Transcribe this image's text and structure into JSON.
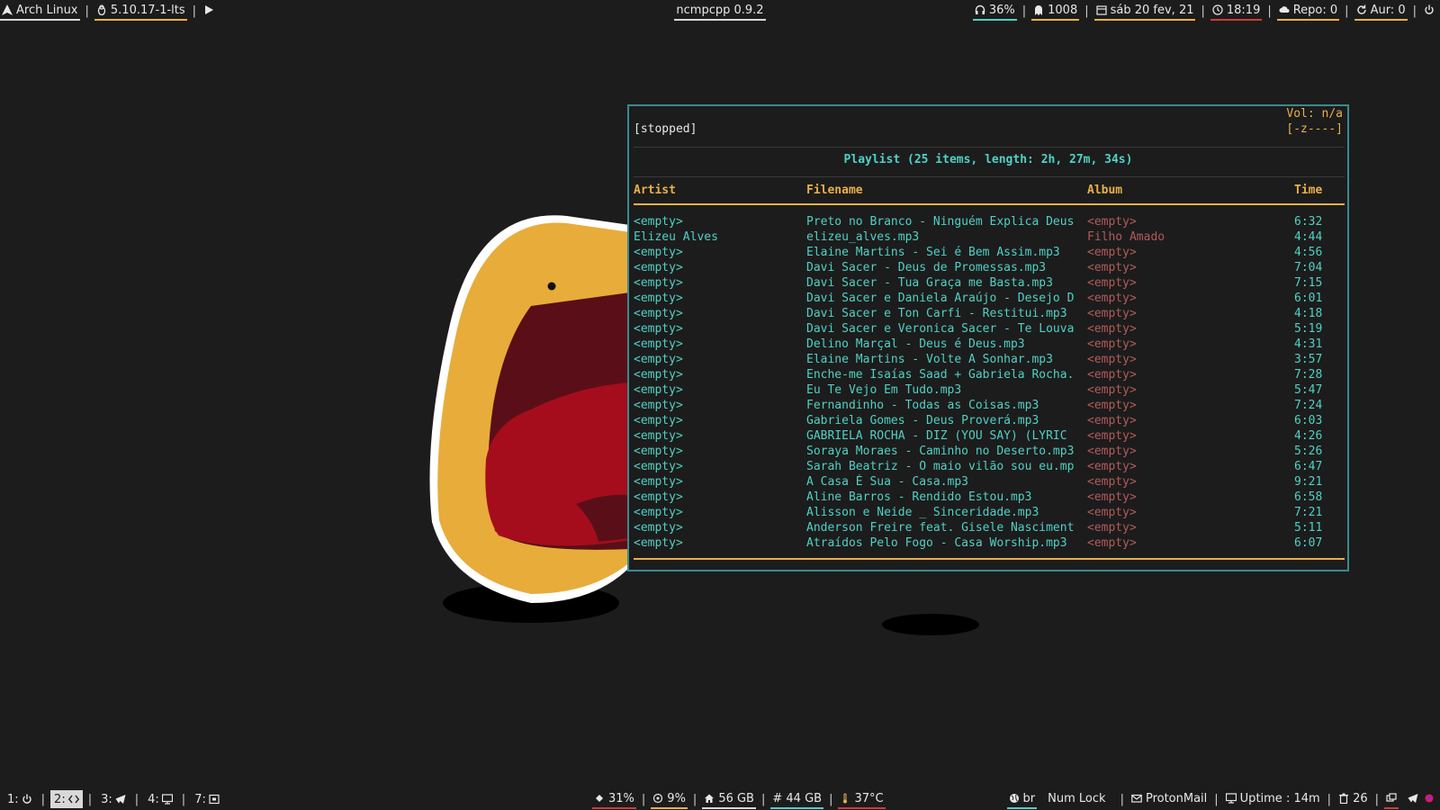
{
  "topbar": {
    "distro": "Arch Linux",
    "kernel": "5.10.17-1-lts",
    "window_title": "ncmpcpp 0.9.2",
    "volume": "36%",
    "processes": "1008",
    "date": "sáb 20 fev, 21",
    "time": "18:19",
    "repo": "Repo: 0",
    "aur": "Aur: 0"
  },
  "bottombar": {
    "workspaces": [
      {
        "label": "1:",
        "icon": "power-icon"
      },
      {
        "label": "2:",
        "icon": "code-icon"
      },
      {
        "label": "3:",
        "icon": "telegram-icon"
      },
      {
        "label": "4:",
        "icon": "monitor-icon"
      },
      {
        "label": "7:",
        "icon": "window-icon"
      }
    ],
    "cpu": "31%",
    "mem": "9%",
    "home": "56 GB",
    "root": "# 44 GB",
    "temp": "37°C",
    "keyboard": "br",
    "numlock": "Num Lock",
    "mail": "ProtonMail",
    "uptime": "Uptime : 14m",
    "trash": "26"
  },
  "player": {
    "state": "[stopped]",
    "volume": "Vol: n/a",
    "flags": "[-z----]",
    "playlist_title": "Playlist (25 items, length: 2h, 27m, 34s)",
    "columns": [
      "Artist",
      "Filename",
      "Album",
      "Time"
    ],
    "rows": [
      [
        "<empty>",
        "Preto no Branco - Ninguém Explica Deus",
        "<empty>",
        "6:32"
      ],
      [
        "Elizeu Alves",
        "elizeu_alves.mp3",
        "Filho Amado",
        "4:44"
      ],
      [
        "<empty>",
        "Elaine Martins - Sei é Bem Assim.mp3",
        "<empty>",
        "4:56"
      ],
      [
        "<empty>",
        "Davi Sacer - Deus de Promessas.mp3",
        "<empty>",
        "7:04"
      ],
      [
        "<empty>",
        "Davi Sacer - Tua Graça me Basta.mp3",
        "<empty>",
        "7:15"
      ],
      [
        "<empty>",
        "Davi Sacer e Daniela Araújo - Desejo D",
        "<empty>",
        "6:01"
      ],
      [
        "<empty>",
        "Davi Sacer e Ton Carfi - Restitui.mp3",
        "<empty>",
        "4:18"
      ],
      [
        "<empty>",
        "Davi Sacer e Veronica Sacer - Te Louva",
        "<empty>",
        "5:19"
      ],
      [
        "<empty>",
        "Delino Marçal - Deus é Deus.mp3",
        "<empty>",
        "4:31"
      ],
      [
        "<empty>",
        "Elaine Martins - Volte A Sonhar.mp3",
        "<empty>",
        "3:57"
      ],
      [
        "<empty>",
        "Enche-me Isaías Saad + Gabriela Rocha.",
        "<empty>",
        "7:28"
      ],
      [
        "<empty>",
        "Eu Te Vejo Em Tudo.mp3",
        "<empty>",
        "5:47"
      ],
      [
        "<empty>",
        "Fernandinho - Todas as Coisas.mp3",
        "<empty>",
        "7:24"
      ],
      [
        "<empty>",
        "Gabriela Gomes - Deus Proverá.mp3",
        "<empty>",
        "6:03"
      ],
      [
        "<empty>",
        "GABRIELA ROCHA - DIZ (YOU SAY) (LYRIC",
        "<empty>",
        "4:26"
      ],
      [
        "<empty>",
        "Soraya Moraes - Caminho no Deserto.mp3",
        "<empty>",
        "5:26"
      ],
      [
        "<empty>",
        "Sarah Beatriz - O maio vilão sou eu.mp",
        "<empty>",
        "6:47"
      ],
      [
        "<empty>",
        "A Casa É Sua - Casa.mp3",
        "<empty>",
        "9:21"
      ],
      [
        "<empty>",
        "Aline Barros - Rendido Estou.mp3",
        "<empty>",
        "6:58"
      ],
      [
        "<empty>",
        "Alisson e Neide _ Sinceridade.mp3",
        "<empty>",
        "7:21"
      ],
      [
        "<empty>",
        "Anderson Freire feat. Gisele Nasciment",
        "<empty>",
        "5:11"
      ],
      [
        "<empty>",
        "Atraídos Pelo Fogo - Casa Worship.mp3",
        "<empty>",
        "6:07"
      ]
    ]
  },
  "colors": {
    "background": "#1c1c1c",
    "terminal_border": "#3a8a8f",
    "accent_cyan": "#4fd1c5",
    "accent_gold": "#e8b04a",
    "album_pink": "#b35a5a"
  }
}
